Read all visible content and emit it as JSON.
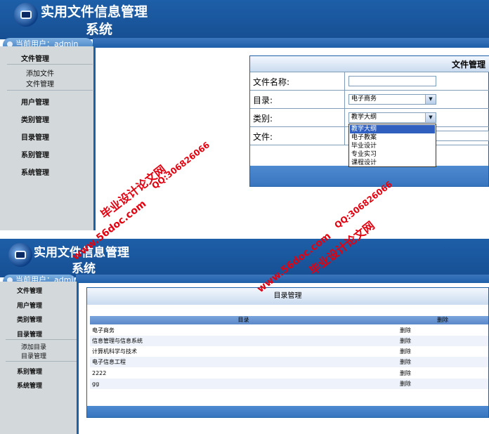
{
  "top": {
    "app_title_line1": "实用文件信息管理",
    "app_title_line2": "系统",
    "userbar_text": "当前用户：admin",
    "sidebar": {
      "items": [
        {
          "label": "文件管理",
          "subitems": [
            "添加文件",
            "文件管理"
          ]
        },
        {
          "label": "用户管理"
        },
        {
          "label": "类别管理"
        },
        {
          "label": "目录管理"
        },
        {
          "label": "系别管理"
        },
        {
          "label": "系统管理"
        }
      ]
    },
    "form": {
      "title": "文件管理",
      "fields": {
        "name_label": "文件名称:",
        "name_value": "",
        "dir_label": "目录:",
        "dir_value": "电子商务",
        "cat_label": "类别:",
        "cat_value": "教学大纲",
        "file_label": "文件:"
      },
      "category_options": [
        "教学大纲",
        "电子教案",
        "毕业设计",
        "专业实习",
        "课程设计"
      ],
      "category_selected_index": 0
    }
  },
  "bottom": {
    "app_title_line1": "实用文件信息管理",
    "app_title_line2": "系统",
    "userbar_text": "当前用户：admin",
    "sidebar": {
      "items": [
        {
          "label": "文件管理"
        },
        {
          "label": "用户管理"
        },
        {
          "label": "类别管理"
        },
        {
          "label": "目录管理",
          "subitems": [
            "添加目录",
            "目录管理"
          ]
        },
        {
          "label": "系别管理"
        },
        {
          "label": "系统管理"
        }
      ]
    },
    "table": {
      "title": "目录管理",
      "headers": [
        "目录",
        "删除"
      ],
      "rows": [
        {
          "dir": "电子商务",
          "action": "删除"
        },
        {
          "dir": "信息管理与信息系统",
          "action": "删除"
        },
        {
          "dir": "计算机科学与技术",
          "action": "删除"
        },
        {
          "dir": "电子信息工程",
          "action": "删除"
        },
        {
          "dir": "2222",
          "action": "删除"
        },
        {
          "dir": "gg",
          "action": "删除"
        }
      ]
    }
  },
  "watermarks": {
    "site_cn": "毕业设计论文网",
    "site_url": "www.56doc.com",
    "qq": "QQ:306826066"
  },
  "colors": {
    "header_blue": "#1d5fa8",
    "sidebar_gray": "#d3d8db",
    "watermark_red": "#e3000f",
    "selected_option": "#2f5fbf"
  }
}
